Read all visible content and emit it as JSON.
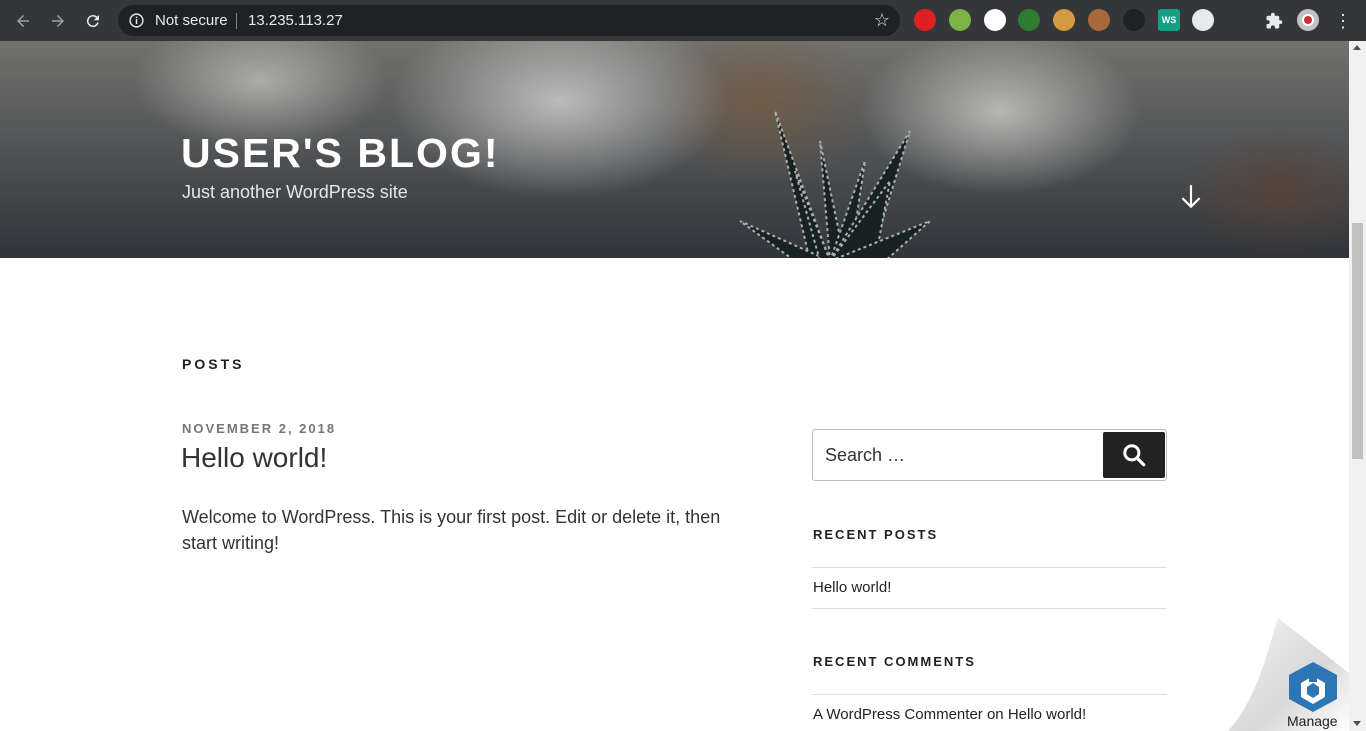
{
  "browser": {
    "security_label": "Not secure",
    "url": "13.235.113.27",
    "extensions": [
      {
        "name": "adblock-icon",
        "color": "#e02020",
        "text": ""
      },
      {
        "name": "extension-green-icon",
        "color": "#7cb342",
        "text": ""
      },
      {
        "name": "screenshot-camera-icon",
        "color": "#ffffff",
        "text": ""
      },
      {
        "name": "extension-leaf-icon",
        "color": "#2e7d32",
        "text": ""
      },
      {
        "name": "cookie-icon",
        "color": "#d59b42",
        "text": ""
      },
      {
        "name": "cookie-editor-icon",
        "color": "#a86a3d",
        "text": ""
      },
      {
        "name": "extension-dark-icon",
        "color": "#202124",
        "text": ""
      },
      {
        "name": "ws-extension-icon",
        "color": "#15a085",
        "text": "WS"
      },
      {
        "name": "grammarly-icon",
        "color": "#e8eaed",
        "text": ""
      },
      {
        "name": "cart-icon",
        "color": "#35363a",
        "text": ""
      }
    ]
  },
  "hero": {
    "site_title": "USER'S BLOG!",
    "site_description": "Just another WordPress site"
  },
  "main": {
    "section_title": "POSTS",
    "post": {
      "date": "NOVEMBER 2, 2018",
      "title": "Hello world!",
      "body": "Welcome to WordPress. This is your first post. Edit or delete it, then start writing!"
    }
  },
  "sidebar": {
    "search_placeholder": "Search …",
    "recent_posts_title": "RECENT POSTS",
    "recent_posts": [
      "Hello world!"
    ],
    "recent_comments_title": "RECENT COMMENTS",
    "recent_comment": {
      "author": "A WordPress Commenter",
      "on": "on",
      "post": "Hello world!"
    }
  },
  "manage_label": "Manage"
}
